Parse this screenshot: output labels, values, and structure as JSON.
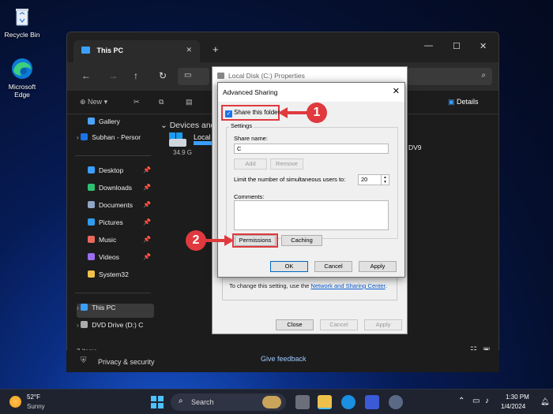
{
  "desktop": {
    "recycle_bin": "Recycle Bin",
    "edge": "Microsoft Edge"
  },
  "explorer": {
    "tab_title": "This PC",
    "tab_close": "✕",
    "new_tab": "+",
    "minimize": "—",
    "maximize": "☐",
    "close": "✕",
    "new_label": "New",
    "details_label": "Details",
    "sidebar": [
      {
        "label": "Gallery",
        "color": "#4aa3ff",
        "pin": false
      },
      {
        "label": "Subhan - Persor",
        "color": "#1a73e8",
        "pin": false
      },
      {
        "label": "Desktop",
        "color": "#3aa0ff",
        "pin": true
      },
      {
        "label": "Downloads",
        "color": "#2fbf71",
        "pin": true
      },
      {
        "label": "Documents",
        "color": "#8fa6c4",
        "pin": true
      },
      {
        "label": "Pictures",
        "color": "#2e9cf0",
        "pin": true
      },
      {
        "label": "Music",
        "color": "#e86a5a",
        "pin": true
      },
      {
        "label": "Videos",
        "color": "#9b6df0",
        "pin": true
      },
      {
        "label": "System32",
        "color": "#f0c14a",
        "pin": false
      },
      {
        "label": "This PC",
        "color": "#3aa0ff",
        "pin": false
      },
      {
        "label": "DVD Drive (D:) C",
        "color": "#aaaaaa",
        "pin": false
      }
    ],
    "pin_glyph": "📌",
    "content_header": "Devices and",
    "drive_label": "Local",
    "drive_size": "34.9 G",
    "dvd_label": "DV9",
    "status_items": "2 items",
    "settings_privacy": "Privacy & security",
    "give_feedback": "Give feedback"
  },
  "properties": {
    "title": "Local Disk (C:) Properties",
    "info_text": "To change this setting, use the",
    "info_link": "Network and Sharing Center",
    "info_suffix": ".",
    "close": "Close",
    "cancel": "Cancel",
    "apply": "Apply"
  },
  "advanced_sharing": {
    "title": "Advanced Sharing",
    "close": "✕",
    "share_checkbox": "Share this folder",
    "settings_legend": "Settings",
    "share_name_label": "Share name:",
    "share_name_value": "C",
    "add": "Add",
    "remove": "Remove",
    "limit_label": "Limit the number of simultaneous users to:",
    "limit_value": "20",
    "comments_label": "Comments:",
    "permissions": "Permissions",
    "caching": "Caching",
    "ok": "OK",
    "cancel": "Cancel",
    "apply": "Apply"
  },
  "callouts": [
    "1",
    "2"
  ],
  "taskbar": {
    "temp": "52°F",
    "condition": "Sunny",
    "search": "Search",
    "time": "1:30 PM",
    "date": "1/4/2024"
  },
  "colors": {
    "callout_red": "#e0393e",
    "accent_blue": "#1a73e8"
  }
}
